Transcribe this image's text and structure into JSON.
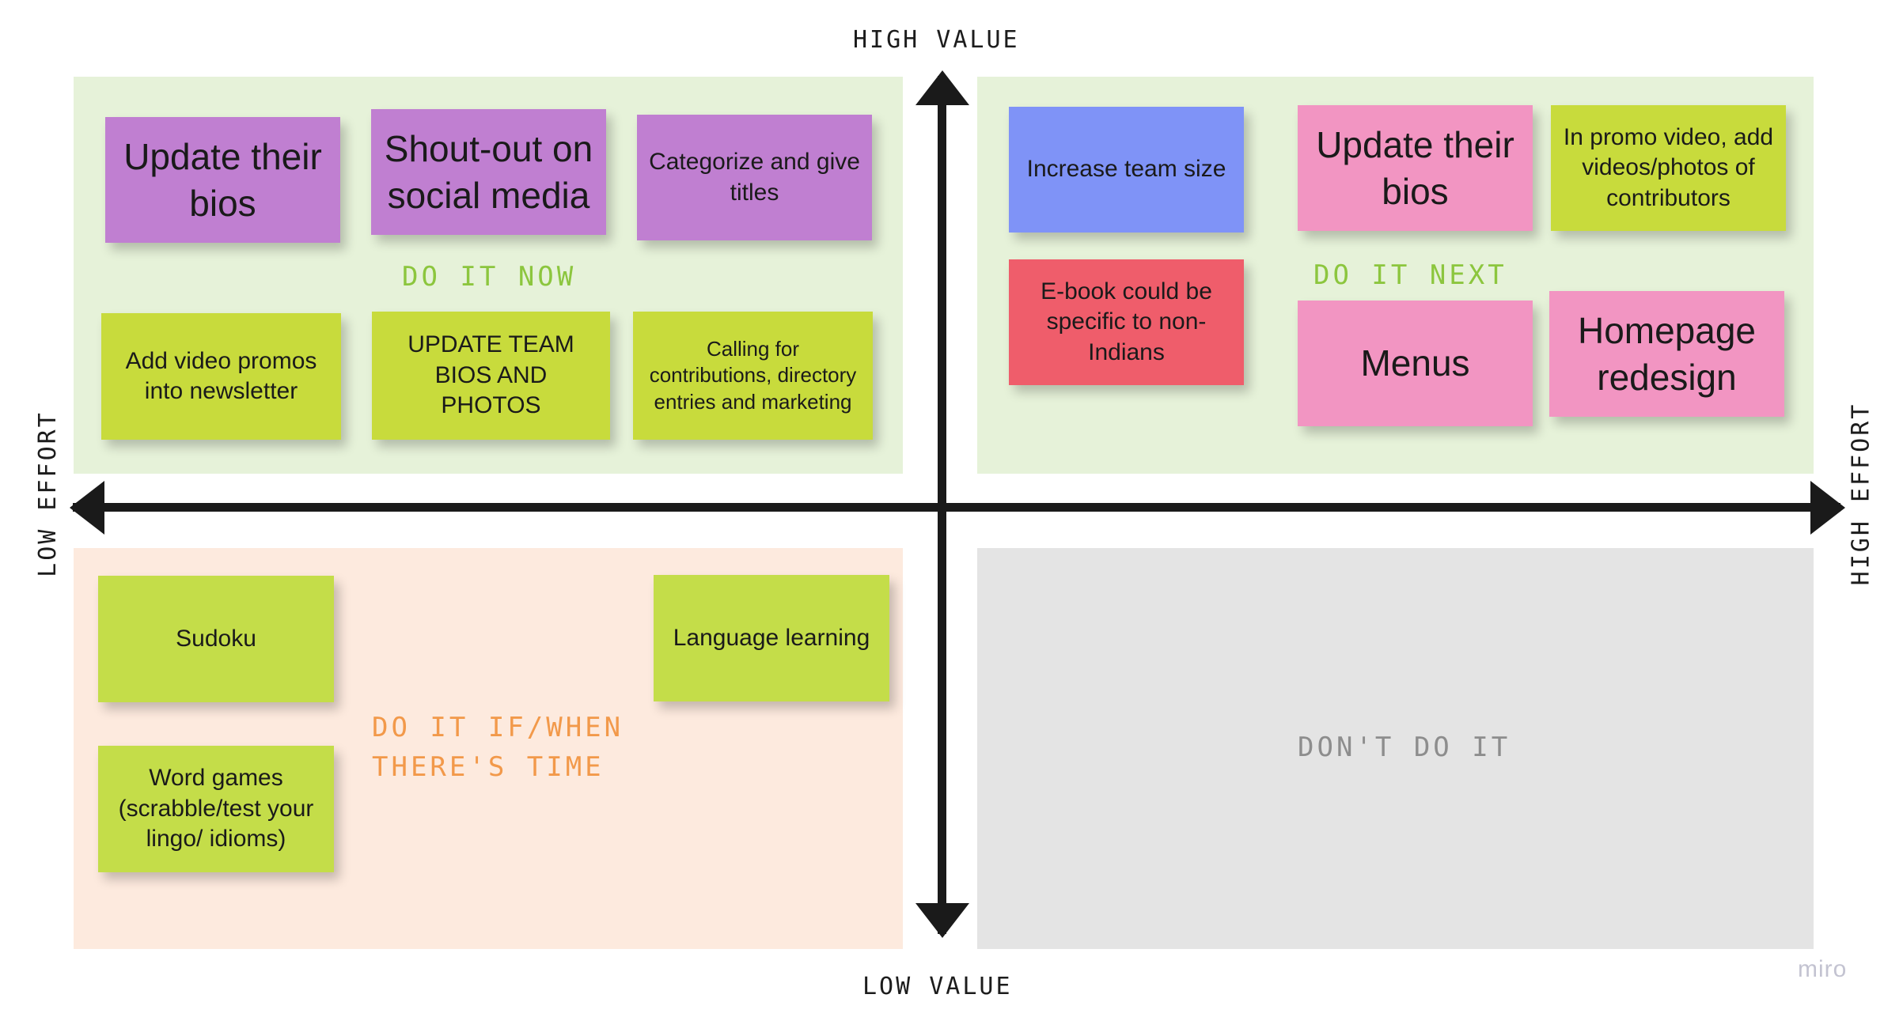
{
  "board": {
    "watermark": "miro"
  },
  "axes": {
    "top": "HIGH VALUE",
    "bottom": "LOW VALUE",
    "left": "LOW EFFORT",
    "right": "HIGH EFFORT"
  },
  "quadrants": [
    {
      "key": "do_now",
      "title": "DO IT NOW",
      "title_color": "#8cc63e",
      "background": "#e6f2d9",
      "notes": [
        {
          "text": "Update their bios",
          "color": "#c07fd1",
          "size": "big"
        },
        {
          "text": "Shout-out on social media",
          "color": "#c07fd1",
          "size": "big"
        },
        {
          "text": "Categorize and give titles",
          "color": "#c07fd1",
          "size": "mid"
        },
        {
          "text": "Add video promos into newsletter",
          "color": "#c8db3c",
          "size": "mid"
        },
        {
          "text": "UPDATE TEAM BIOS AND PHOTOS",
          "color": "#c8db3c",
          "size": "mid"
        },
        {
          "text": "Calling for contributions, directory entries and marketing",
          "color": "#c8db3c",
          "size": "small"
        }
      ]
    },
    {
      "key": "do_next",
      "title": "DO IT NEXT",
      "title_color": "#8cc63e",
      "background": "#e6f2d9",
      "notes": [
        {
          "text": "Increase team size",
          "color": "#7f93f7",
          "size": "mid"
        },
        {
          "text": "E-book could be specific to non-Indians",
          "color": "#ef5d6b",
          "size": "mid"
        },
        {
          "text": "Update their bios",
          "color": "#f295c2",
          "size": "big"
        },
        {
          "text": "In promo video, add videos/photos of contributors",
          "color": "#c8db3c",
          "size": "mid"
        },
        {
          "text": "Menus",
          "color": "#f295c2",
          "size": "big"
        },
        {
          "text": "Homepage redesign",
          "color": "#f295c2",
          "size": "big"
        }
      ]
    },
    {
      "key": "if_time",
      "title": "DO IT IF/WHEN\nTHERE'S TIME",
      "title_color": "#f2994a",
      "background": "#fdeade",
      "notes": [
        {
          "text": "Sudoku",
          "color": "#c4dd49",
          "size": "mid"
        },
        {
          "text": "Word games (scrabble/test your lingo/ idioms)",
          "color": "#c4dd49",
          "size": "mid"
        },
        {
          "text": "Language learning",
          "color": "#c4dd49",
          "size": "mid"
        }
      ]
    },
    {
      "key": "dont_do_it",
      "title": "DON'T DO IT",
      "title_color": "#8d8d8d",
      "background": "#e4e4e4",
      "notes": []
    }
  ]
}
